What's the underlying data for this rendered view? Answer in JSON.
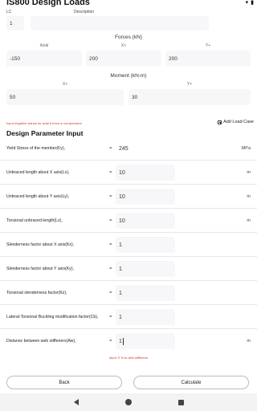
{
  "title": "IS800 Design Loads",
  "status_icons": [
    "wifi-icon",
    "battery-icon"
  ],
  "lc": {
    "label": "LC",
    "value": "1"
  },
  "description": {
    "label": "Description",
    "value": ""
  },
  "forces": {
    "title": "Forces (kN)",
    "labels": [
      "Axial",
      "X+",
      "Y+"
    ],
    "values": [
      "-150",
      "200",
      "200"
    ]
  },
  "moment": {
    "title": "Moment (kN-m)",
    "labels": [
      "X+",
      "Y+"
    ],
    "values": [
      "50",
      "30"
    ]
  },
  "compression_note": "Input negative values for axial if force is compression",
  "add_load_case": "Add Load Case",
  "design_title": "Design Parameter Input",
  "params": [
    {
      "label": "Yield Stress of the member(Fy),",
      "eq": "=",
      "value": "245",
      "unit": "MPa"
    },
    {
      "label": "Unbraced length about X axis(Lx),",
      "eq": "=",
      "value": "10",
      "unit": "m"
    },
    {
      "label": "Unbraced length about Y axis(Ly),",
      "eq": "=",
      "value": "10",
      "unit": "m"
    },
    {
      "label": "Torsional unbraced length(Lz),",
      "eq": "=",
      "value": "10",
      "unit": "m"
    },
    {
      "label": "Slenderness factor about X axis(Kx),",
      "eq": "=",
      "value": "1",
      "unit": ""
    },
    {
      "label": "Slenderness factor about Y axis(Ky),",
      "eq": "=",
      "value": "1",
      "unit": ""
    },
    {
      "label": "Torsional slenderness factor(Kz),",
      "eq": "=",
      "value": "1",
      "unit": ""
    },
    {
      "label": "Lateral-Torsional Buckling modification factor(Cb),",
      "eq": "=",
      "value": "1",
      "unit": ""
    },
    {
      "label": "Distance between web stiffeners(Aw),",
      "eq": "=",
      "value": "1",
      "unit": "m"
    }
  ],
  "stiffener_hint": "Input '0' if no web stiffeners",
  "buttons": {
    "back": "Back",
    "calculate": "Calculate"
  }
}
